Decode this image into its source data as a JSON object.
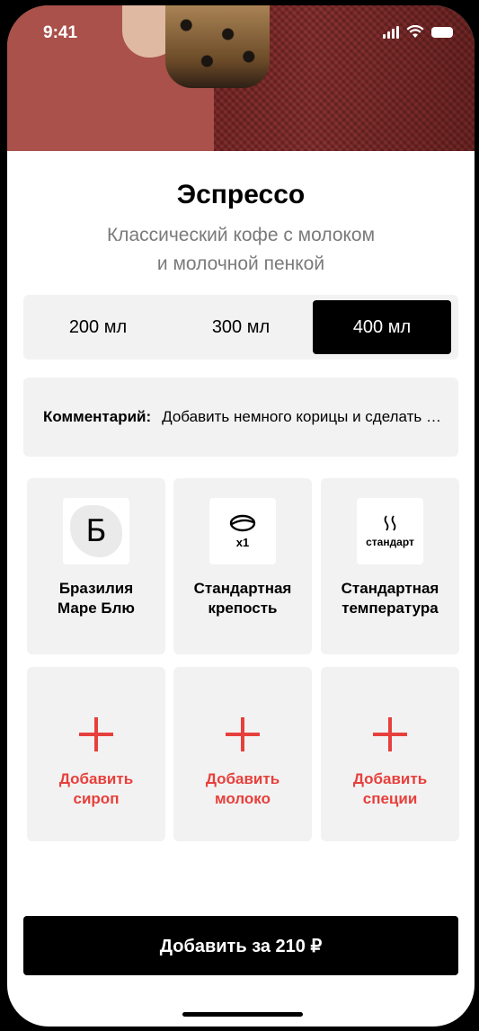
{
  "status_bar": {
    "time": "9:41"
  },
  "product": {
    "title": "Эспрессо",
    "subtitle_line1": "Классический кофе с молоком",
    "subtitle_line2": "и молочной пенкой"
  },
  "sizes": [
    {
      "label": "200 мл",
      "selected": false
    },
    {
      "label": "300 мл",
      "selected": false
    },
    {
      "label": "400 мл",
      "selected": true
    }
  ],
  "comment": {
    "label": "Комментарий:",
    "value": "Добавить немного корицы и сделать покрепче"
  },
  "options": [
    {
      "icon": "brazil-map-icon",
      "icon_text": "Б",
      "label_line1": "Бразилия",
      "label_line2": "Маре Блю"
    },
    {
      "icon": "coffee-bean-icon",
      "icon_text": "x1",
      "label_line1": "Стандартная",
      "label_line2": "крепость"
    },
    {
      "icon": "steam-icon",
      "icon_text": "стандарт",
      "label_line1": "Стандартная",
      "label_line2": "температура"
    }
  ],
  "additions": [
    {
      "icon": "plus-icon",
      "label_line1": "Добавить",
      "label_line2": "сироп"
    },
    {
      "icon": "plus-icon",
      "label_line1": "Добавить",
      "label_line2": "молоко"
    },
    {
      "icon": "plus-icon",
      "label_line1": "Добавить",
      "label_line2": "специи"
    }
  ],
  "cta": {
    "label": "Добавить за 210 ₽"
  },
  "colors": {
    "accent": "#e7403c",
    "primary": "#000000",
    "tile_bg": "#f2f2f2",
    "subtitle": "#7a7a7a"
  }
}
